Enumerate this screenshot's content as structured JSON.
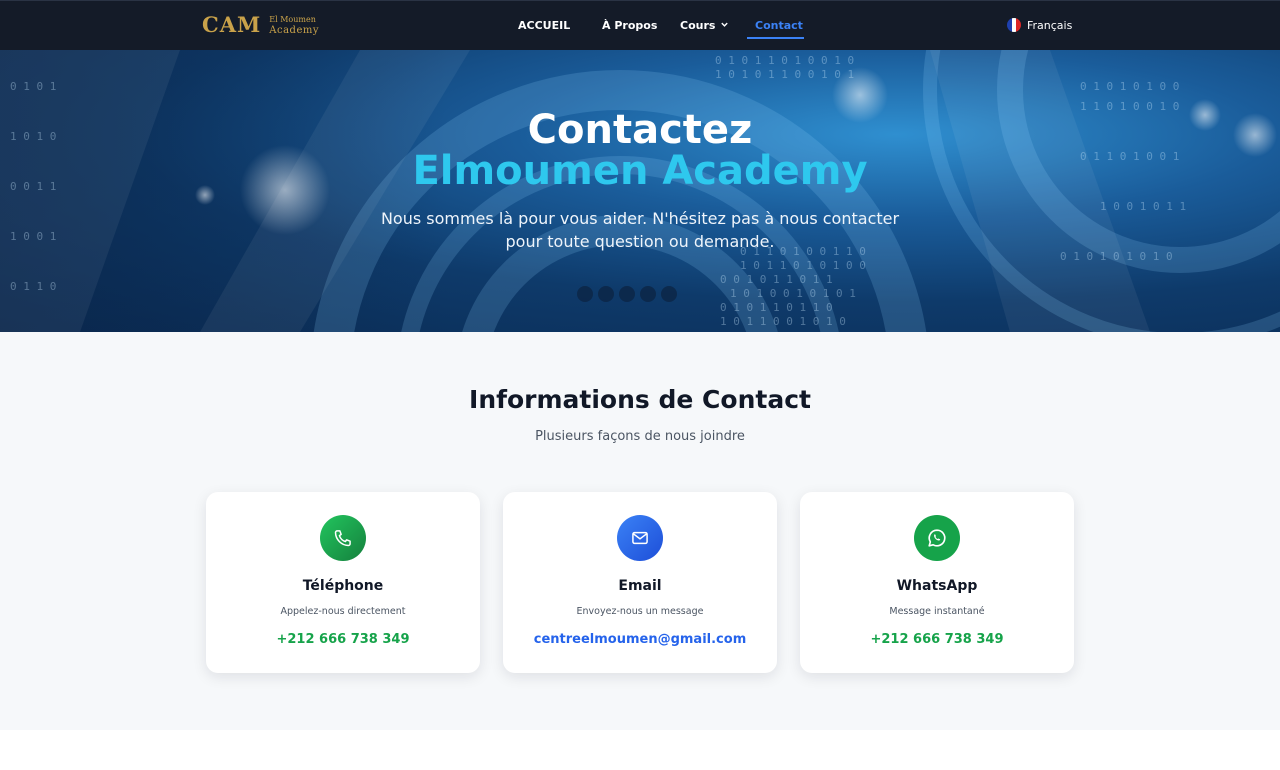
{
  "nav": {
    "logo_mark": "CAM",
    "logo_line1": "El Moumen",
    "logo_line2": "Academy",
    "items": [
      {
        "label": "ACCUEIL"
      },
      {
        "label": "À Propos"
      },
      {
        "label": "Cours"
      },
      {
        "label": "Contact"
      }
    ],
    "active": "Contact",
    "language": "Français"
  },
  "hero": {
    "title_line1": "Contactez",
    "title_line2": "Elmoumen Academy",
    "subtitle_line1": "Nous sommes là pour vous aider. N'hésitez pas à nous contacter",
    "subtitle_line2": "pour toute question ou demande."
  },
  "contact": {
    "title": "Informations de Contact",
    "subtitle": "Plusieurs façons de nous joindre",
    "cards": [
      {
        "title": "Téléphone",
        "description": "Appelez-nous directement",
        "value": "+212 666 738 349",
        "icon": "phone-icon",
        "color": "#16a34a"
      },
      {
        "title": "Email",
        "description": "Envoyez-nous un message",
        "value": "centreelmoumen@gmail.com",
        "icon": "mail-icon",
        "color": "#2563eb"
      },
      {
        "title": "WhatsApp",
        "description": "Message instantané",
        "value": "+212 666 738 349",
        "icon": "whatsapp-icon",
        "color": "#16a34a"
      }
    ]
  },
  "colors": {
    "nav_bg": "#141b28",
    "accent_blue": "#3b82f6",
    "hero_cyan": "#2ec8ee",
    "logo_gold": "#c9a24a",
    "green": "#16a34a"
  }
}
